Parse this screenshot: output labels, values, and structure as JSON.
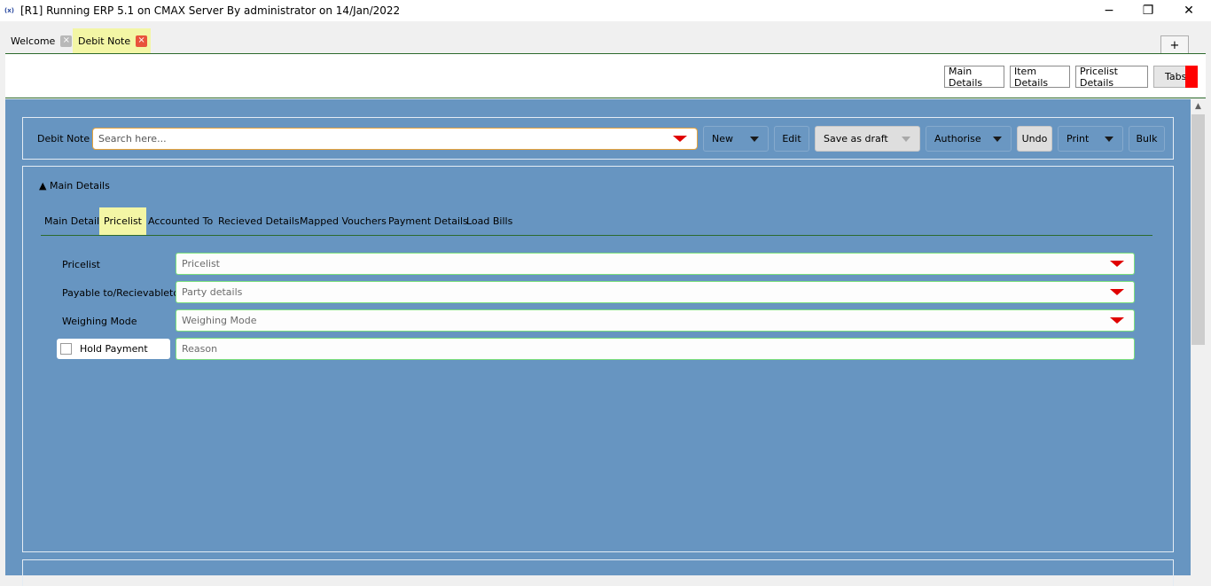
{
  "window": {
    "title": "[R1] Running ERP 5.1 on CMAX Server By administrator on 14/Jan/2022",
    "app_icon": "(x)",
    "minimize": "−",
    "maximize": "❐",
    "close": "✕"
  },
  "tabs": [
    {
      "label": "Welcome",
      "close": "×",
      "active": false
    },
    {
      "label": "Debit Note",
      "close": "×",
      "active": true
    }
  ],
  "add_tab_label": "+",
  "topbar": {
    "main_details": "Main Details",
    "item_details": "Item Details",
    "pricelist_details": "Pricelist Details",
    "tabs": "Tabs"
  },
  "toolbar": {
    "label": "Debit Note",
    "search_placeholder": "Search here...",
    "new": "New",
    "edit": "Edit",
    "save_as_draft": "Save as draft",
    "authorise": "Authorise",
    "undo": "Undo",
    "print": "Print",
    "bulk": "Bulk"
  },
  "details": {
    "section_title": "▲ Main Details",
    "sub_tabs": [
      "Main Details",
      "Pricelist",
      "Accounted To",
      "Recieved Details",
      "Mapped Vouchers",
      "Payment Details",
      "Load Bills"
    ],
    "active_sub_tab": "Pricelist",
    "fields": [
      {
        "label": "Pricelist",
        "placeholder": "Pricelist"
      },
      {
        "label": "Payable to/Recievableto",
        "placeholder": "Party details"
      },
      {
        "label": "Weighing Mode",
        "placeholder": "Weighing Mode"
      }
    ],
    "hold_payment": {
      "label": "Hold Payment",
      "checked": false,
      "reason_placeholder": "Reason"
    }
  },
  "colors": {
    "main_bg": "#6795c1",
    "active_tab": "#f3f6a5",
    "accent_red": "#e00000",
    "field_border": "#7ce07c",
    "divider_green": "#2d6a2d"
  }
}
